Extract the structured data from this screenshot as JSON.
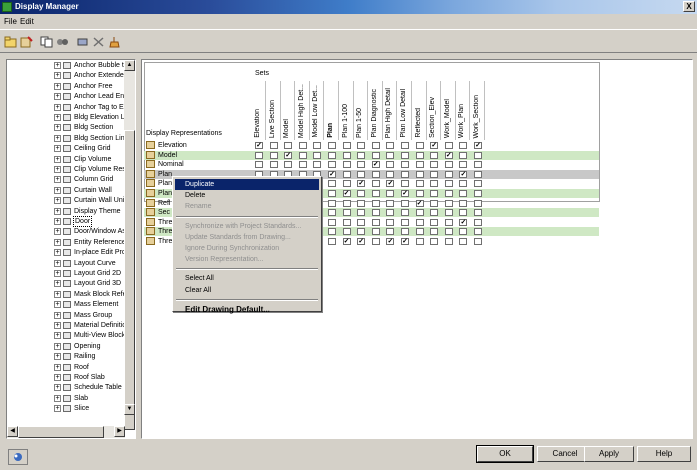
{
  "window": {
    "title": "Display Manager",
    "close_label": "X"
  },
  "menu": [
    "File",
    "Edit"
  ],
  "toolbar": {
    "buttons": [
      "open-folder-icon",
      "new-representation-icon",
      "copy-icon",
      "cut-icon",
      "delete-icon",
      "purge-icon"
    ]
  },
  "tree": {
    "items": [
      "Anchor Bubble to",
      "Anchor Extended",
      "Anchor Free",
      "Anchor Lead Entit",
      "Anchor Tag to Ent",
      "Bldg Elevation Line",
      "Bldg Section",
      "Bldg Section Line",
      "Ceiling Grid",
      "Clip Volume",
      "Clip Volume Result",
      "Column Grid",
      "Curtain Wall",
      "Curtain Wall Unit",
      "Display Theme",
      "Door",
      "Door/Window Ass",
      "Entity Reference",
      "In-place Edit Profi",
      "Layout Curve",
      "Layout Grid 2D",
      "Layout Grid 3D",
      "Mask Block Refere",
      "Mass Element",
      "Mass Group",
      "Material Definition",
      "Multi-View Block R",
      "Opening",
      "Railing",
      "Roof",
      "Roof Slab",
      "Schedule Table",
      "Slab",
      "Slice"
    ],
    "selected": "Door"
  },
  "grid": {
    "sets_label": "Sets",
    "rep_header": "Display Representations",
    "columns": [
      "Elevation",
      "Live Section",
      "Model",
      "Model High Det...",
      "Model Low Det...",
      "Plan",
      "Plan 1-100",
      "Plan 1-50",
      "Plan Diagnostic",
      "Plan High Detail",
      "Plan Low Detail",
      "Reflected",
      "Section_Elev",
      "Work_Model",
      "Work_Plan",
      "Work_Section"
    ],
    "bold_column": "Plan",
    "rows": [
      {
        "label": "Elevation",
        "style": "white",
        "checks": [
          1,
          0,
          0,
          0,
          0,
          0,
          0,
          0,
          0,
          0,
          0,
          0,
          1,
          0,
          0,
          1
        ]
      },
      {
        "label": "Model",
        "style": "green",
        "checks": [
          0,
          0,
          1,
          0,
          0,
          0,
          0,
          0,
          0,
          0,
          0,
          0,
          0,
          1,
          0,
          0
        ]
      },
      {
        "label": "Nominal",
        "style": "white",
        "checks": [
          0,
          0,
          0,
          0,
          0,
          0,
          0,
          0,
          1,
          0,
          0,
          0,
          0,
          0,
          0,
          0
        ]
      },
      {
        "label": "Plan",
        "style": "gray",
        "checks": [
          0,
          0,
          0,
          0,
          0,
          1,
          0,
          0,
          0,
          0,
          0,
          0,
          0,
          0,
          1,
          0
        ]
      },
      {
        "label": "Plan",
        "style": "white",
        "checks": [
          0,
          0,
          0,
          0,
          0,
          0,
          0,
          1,
          0,
          1,
          0,
          0,
          0,
          0,
          0,
          0
        ]
      },
      {
        "label": "Plan",
        "style": "green",
        "checks": [
          0,
          0,
          0,
          0,
          0,
          0,
          1,
          0,
          0,
          0,
          1,
          0,
          0,
          0,
          0,
          0
        ]
      },
      {
        "label": "Refl",
        "style": "white",
        "checks": [
          0,
          0,
          0,
          0,
          0,
          0,
          0,
          0,
          0,
          0,
          0,
          1,
          0,
          0,
          0,
          0
        ]
      },
      {
        "label": "Sec",
        "style": "green",
        "checks": [
          0,
          0,
          0,
          0,
          0,
          0,
          0,
          0,
          0,
          0,
          0,
          0,
          0,
          0,
          0,
          0
        ]
      },
      {
        "label": "Thre",
        "style": "white",
        "checks": [
          0,
          0,
          0,
          0,
          0,
          0,
          0,
          0,
          0,
          0,
          0,
          0,
          0,
          0,
          1,
          0
        ]
      },
      {
        "label": "Thre",
        "style": "green",
        "checks": [
          0,
          0,
          0,
          0,
          0,
          0,
          0,
          0,
          0,
          0,
          0,
          0,
          0,
          0,
          0,
          0
        ]
      },
      {
        "label": "Thre",
        "style": "white",
        "checks": [
          0,
          0,
          0,
          0,
          0,
          0,
          1,
          1,
          0,
          1,
          1,
          0,
          0,
          0,
          0,
          0
        ]
      }
    ]
  },
  "context_menu": {
    "items": [
      {
        "label": "Duplicate",
        "state": "highlighted"
      },
      {
        "label": "Delete",
        "state": "enabled"
      },
      {
        "label": "Rename",
        "state": "disabled"
      },
      {
        "label": "-",
        "state": "separator"
      },
      {
        "label": "Synchronize with Project Standards...",
        "state": "disabled"
      },
      {
        "label": "Update Standards from Drawing...",
        "state": "disabled"
      },
      {
        "label": "Ignore During Synchronization",
        "state": "disabled"
      },
      {
        "label": "Version Representation...",
        "state": "disabled"
      },
      {
        "label": "-",
        "state": "separator"
      },
      {
        "label": "Select All",
        "state": "enabled"
      },
      {
        "label": "Clear All",
        "state": "enabled"
      },
      {
        "label": "-",
        "state": "separator"
      },
      {
        "label": "Edit Drawing Default...",
        "state": "bold"
      }
    ]
  },
  "buttons": {
    "ok": "OK",
    "cancel": "Cancel",
    "apply": "Apply",
    "help": "Help"
  },
  "colors": {
    "green_row": "#cfe8c4",
    "selection": "#0a246a",
    "title_start": "#0a246a"
  }
}
